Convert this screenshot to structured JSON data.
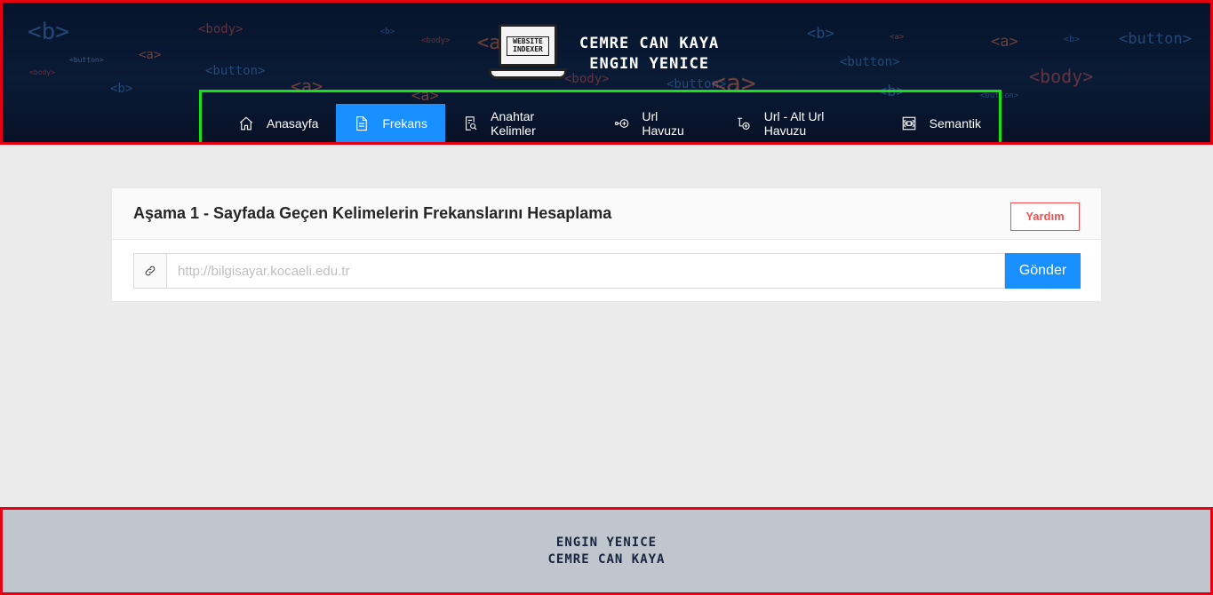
{
  "header": {
    "logo_text_line1": "WEBSITE",
    "logo_text_line2": "INDEXER",
    "author1": "CEMRE CAN KAYA",
    "author2": "ENGIN YENICE",
    "background_tags": [
      "<b>",
      "<body>",
      "<a>",
      "<button>",
      "<b>",
      "<body>",
      "<a>",
      "<button>",
      "<body>",
      "<a>",
      "<b>",
      "<body>",
      "<button>",
      "<a>",
      "<b>",
      "<button>",
      "<a>",
      "<b>",
      "<body>",
      "<button>",
      "<a>",
      "<b>",
      "<a>",
      "<button>"
    ]
  },
  "nav": {
    "items": [
      {
        "label": "Anasayfa",
        "icon": "home-icon"
      },
      {
        "label": "Frekans",
        "icon": "file-text-icon",
        "active": true
      },
      {
        "label": "Anahtar Kelimler",
        "icon": "file-search-icon"
      },
      {
        "label": "Url Havuzu",
        "icon": "node-plus-icon"
      },
      {
        "label": "Url - Alt Url Havuzu",
        "icon": "branch-plus-icon"
      },
      {
        "label": "Semantik",
        "icon": "command-icon"
      }
    ]
  },
  "card": {
    "title": "Aşama 1 - Sayfada Geçen Kelimelerin Frekanslarını Hesaplama",
    "help_label": "Yardım",
    "input": {
      "value": "",
      "placeholder": "http://bilgisayar.kocaeli.edu.tr"
    },
    "send_label": "Gönder"
  },
  "footer": {
    "line1": "ENGIN YENICE",
    "line2": "CEMRE CAN KAYA"
  },
  "colors": {
    "accent": "#1890ff",
    "danger": "#ff4d4f",
    "header_bg": "#0a1b36",
    "footer_bg": "#c0c6ce"
  }
}
